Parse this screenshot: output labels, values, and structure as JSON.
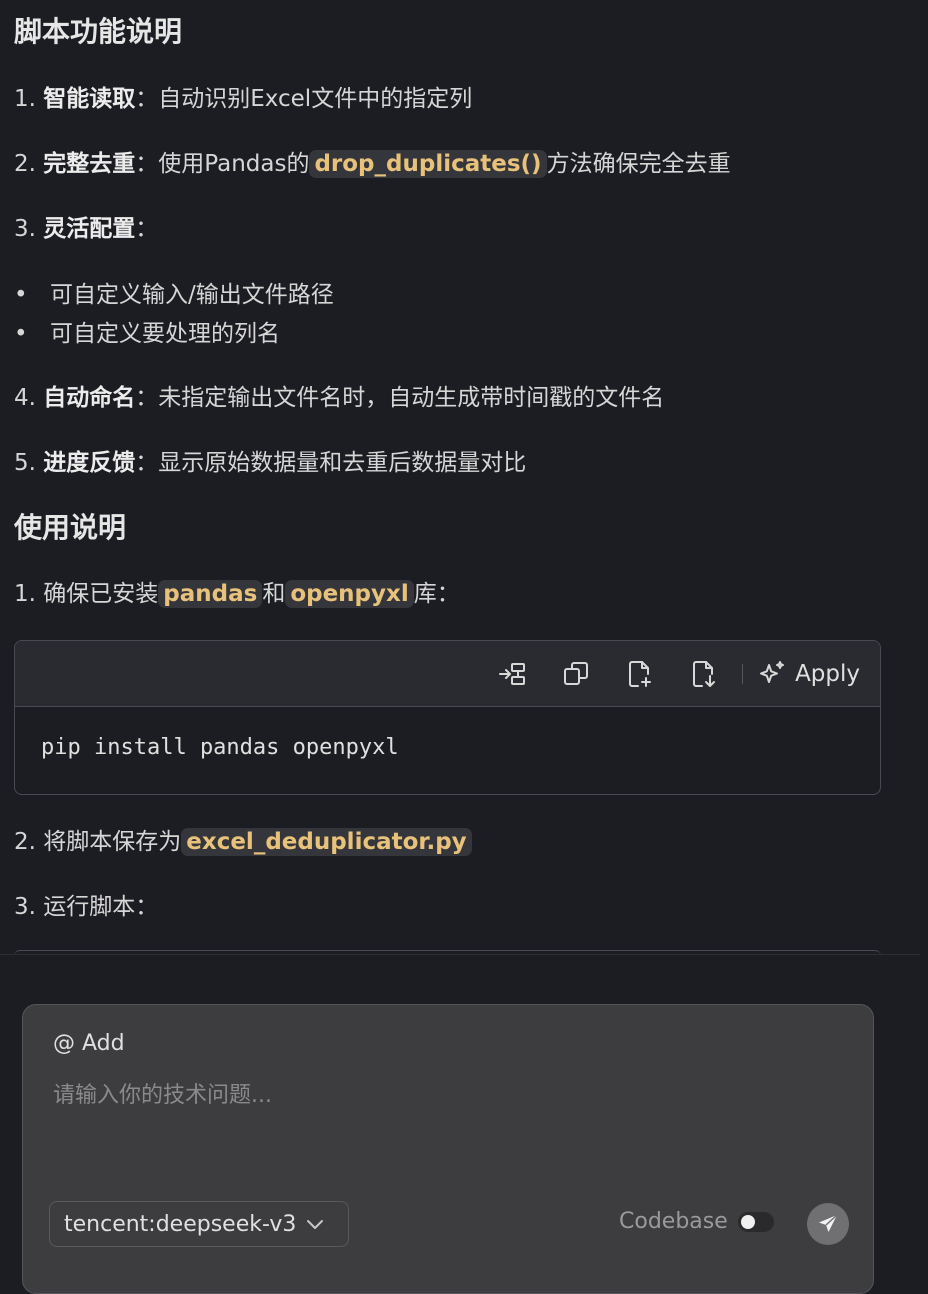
{
  "features": {
    "heading": "脚本功能说明",
    "items": [
      {
        "num": "1.",
        "title": "智能读取",
        "sep": "：",
        "text": "自动识别Excel文件中的指定列"
      },
      {
        "num": "2.",
        "title": "完整去重",
        "sep": "：",
        "text_before": "使用Pandas的",
        "code": "drop_duplicates()",
        "text_after": "方法确保完全去重"
      },
      {
        "num": "3.",
        "title": "灵活配置",
        "sep": "："
      },
      {
        "num": "4.",
        "title": "自动命名",
        "sep": "：",
        "text": "未指定输出文件名时，自动生成带时间戳的文件名"
      },
      {
        "num": "5.",
        "title": "进度反馈",
        "sep": "：",
        "text": "显示原始数据量和去重后数据量对比"
      }
    ],
    "bullets": [
      "可自定义输入/输出文件路径",
      "可自定义要处理的列名"
    ]
  },
  "usage": {
    "heading": "使用说明",
    "step1": {
      "num": "1.",
      "text_before": "确保已安装",
      "code1": "pandas",
      "mid": "和",
      "code2": "openpyxl",
      "text_after": "库："
    },
    "code_block": {
      "command": "pip install pandas openpyxl",
      "apply_label": "Apply"
    },
    "step2": {
      "num": "2.",
      "text_before": "将脚本保存为",
      "code": "excel_deduplicator.py"
    },
    "step3": {
      "num": "3.",
      "text": "运行脚本："
    }
  },
  "composer": {
    "add_label": "@ Add",
    "placeholder": "请输入你的技术问题...",
    "model": "tencent:deepseek-v3",
    "codebase_label": "Codebase",
    "codebase_enabled": false
  }
}
